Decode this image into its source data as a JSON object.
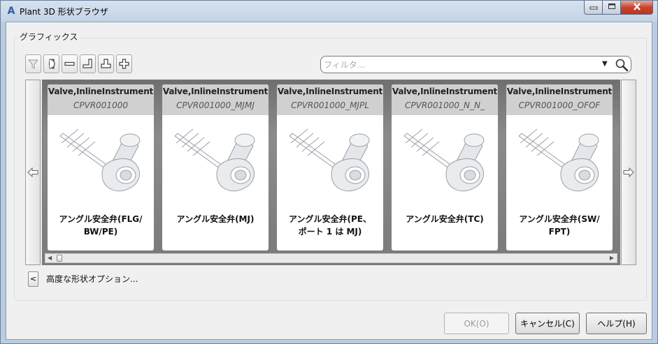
{
  "window": {
    "logo": "A",
    "title": "Plant 3D 形状ブラウザ",
    "controls": {
      "minimize_icon": "minimize-icon",
      "maximize_icon": "maximize-icon",
      "close_icon": "close-icon"
    }
  },
  "group": {
    "label": "グラフィックス"
  },
  "toolbar": {
    "tools": [
      {
        "name": "filter-icon",
        "enabled": false
      },
      {
        "name": "half-circle-icon",
        "enabled": true
      },
      {
        "name": "minus-icon",
        "enabled": true
      },
      {
        "name": "elbow-icon",
        "enabled": true
      },
      {
        "name": "tee-icon",
        "enabled": true
      },
      {
        "name": "cross-icon",
        "enabled": true
      }
    ]
  },
  "filter": {
    "placeholder": "フィルタ...",
    "value": ""
  },
  "cards": [
    {
      "class": "Valve,InlineInstrument",
      "code": "CPVR001000",
      "name_line1": "アングル安全弁(FLG/",
      "name_line2": "BW/PE)"
    },
    {
      "class": "Valve,InlineInstrument",
      "code": "CPVR001000_MJMJ",
      "name_line1": "アングル安全弁(MJ)",
      "name_line2": ""
    },
    {
      "class": "Valve,InlineInstrument",
      "code": "CPVR001000_MJPL",
      "name_line1": "アングル安全弁(PE、",
      "name_line2": "ポート 1 は MJ)"
    },
    {
      "class": "Valve,InlineInstrument",
      "code": "CPVR001000_N_N_",
      "name_line1": "アングル安全弁(TC)",
      "name_line2": ""
    },
    {
      "class": "Valve,InlineInstrument",
      "code": "CPVR001000_OFOF",
      "name_line1": "アングル安全弁(SW/",
      "name_line2": "FPT)"
    }
  ],
  "advanced": {
    "toggle": "<",
    "label": "高度な形状オプション..."
  },
  "buttons": {
    "ok": "OK(O)",
    "cancel": "キャンセル(C)",
    "help": "ヘルプ(H)"
  },
  "colors": {
    "accent": "#2b5ea8",
    "close": "#c8442c",
    "card_header": "#d0d0d0",
    "viewport": "#7a7a7a"
  }
}
